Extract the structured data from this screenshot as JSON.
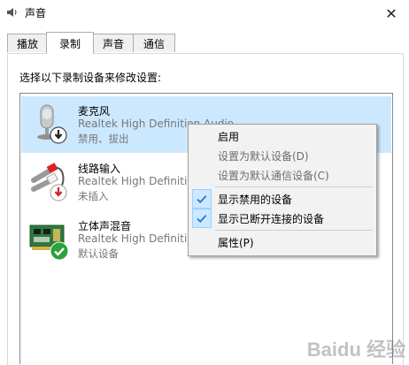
{
  "window": {
    "title": "声音"
  },
  "tabs": [
    {
      "label": "播放"
    },
    {
      "label": "录制"
    },
    {
      "label": "声音"
    },
    {
      "label": "通信"
    }
  ],
  "panel": {
    "instruction": "选择以下录制设备来修改设置:"
  },
  "devices": [
    {
      "name": "麦克风",
      "driver": "Realtek High Definition Audio",
      "status": "禁用、拔出",
      "icon": "microphone-icon",
      "badge": "disabled-arrow-icon"
    },
    {
      "name": "线路输入",
      "driver": "Realtek High Definition Audio",
      "status": "未插入",
      "icon": "line-in-cable-icon",
      "badge": "unplugged-arrow-icon"
    },
    {
      "name": "立体声混音",
      "driver": "Realtek High Definition Audio",
      "status": "默认设备",
      "icon": "sound-card-icon",
      "badge": "default-check-icon"
    }
  ],
  "context_menu": {
    "items": [
      {
        "label": "启用",
        "enabled": true,
        "checked": false
      },
      {
        "label": "设置为默认设备(D)",
        "enabled": false,
        "checked": false
      },
      {
        "label": "设置为默认通信设备(C)",
        "enabled": false,
        "checked": false
      },
      {
        "label": "显示禁用的设备",
        "enabled": true,
        "checked": true
      },
      {
        "label": "显示已断开连接的设备",
        "enabled": true,
        "checked": true
      },
      {
        "label": "属性(P)",
        "enabled": true,
        "checked": false
      }
    ]
  },
  "watermark": {
    "text": "Baidu 经验"
  },
  "colors": {
    "selection": "#cce8ff",
    "check_blue": "#1e73d8",
    "default_green": "#2aa33a",
    "badge_red": "#d12222"
  }
}
